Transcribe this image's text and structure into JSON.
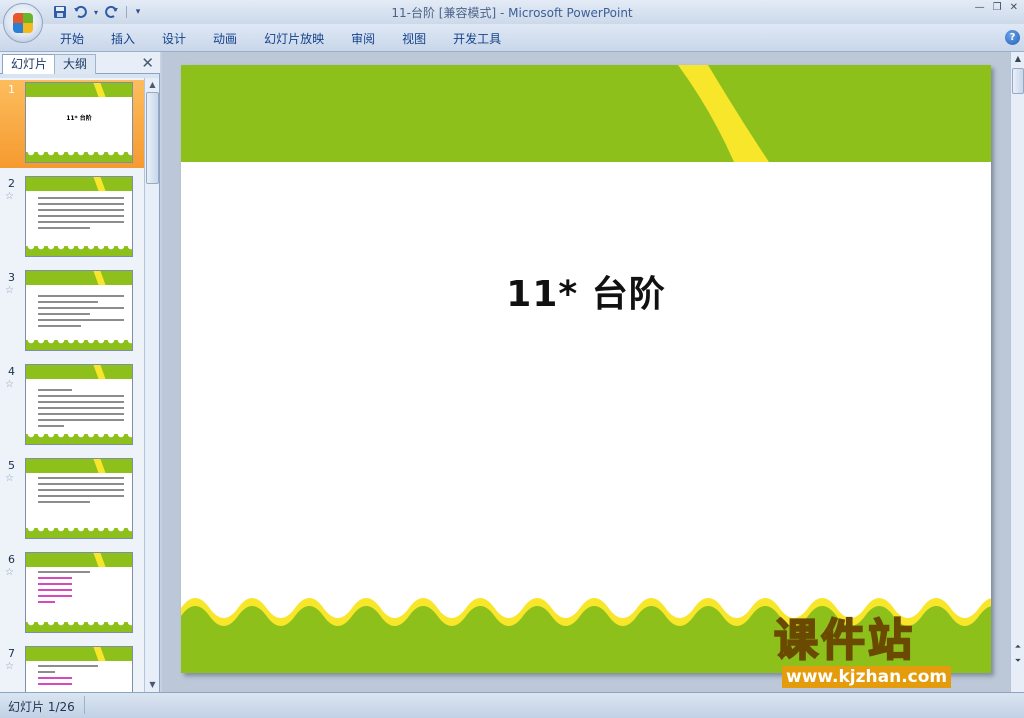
{
  "window": {
    "title_doc": "11-台阶 [兼容模式] - ",
    "title_app": "Microsoft PowerPoint"
  },
  "ribbon": {
    "tabs": [
      "开始",
      "插入",
      "设计",
      "动画",
      "幻灯片放映",
      "审阅",
      "视图",
      "开发工具"
    ]
  },
  "left_panel": {
    "tab_slides": "幻灯片",
    "tab_outline": "大纲",
    "slides": [
      {
        "num": "1",
        "title": "11* 台阶",
        "kind": "title"
      },
      {
        "num": "2",
        "kind": "text"
      },
      {
        "num": "3",
        "kind": "text"
      },
      {
        "num": "4",
        "kind": "text"
      },
      {
        "num": "5",
        "kind": "text"
      },
      {
        "num": "6",
        "kind": "list"
      },
      {
        "num": "7",
        "kind": "list"
      }
    ]
  },
  "slide": {
    "title": "11* 台阶"
  },
  "watermark": {
    "brand": "课件站",
    "url": "www.kjzhan.com"
  },
  "status": {
    "slide_counter": "幻灯片 1/26"
  },
  "colors": {
    "slide_green": "#8ec01c",
    "slide_yellow": "#f7e62a",
    "selection_orange": "#f59a30"
  }
}
